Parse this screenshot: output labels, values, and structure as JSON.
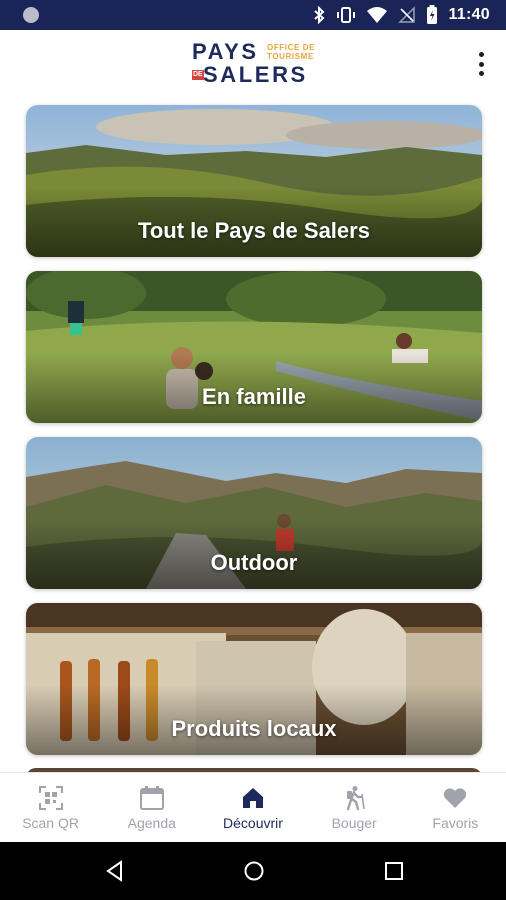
{
  "status_bar": {
    "time": "11:40",
    "icons": [
      "bluetooth-icon",
      "vibrate-icon",
      "wifi-icon",
      "no-signal-icon",
      "battery-icon"
    ]
  },
  "header": {
    "logo": {
      "line1": "PAYS",
      "line2": "SALERS",
      "de": "DE",
      "sub1": "OFFICE DE",
      "sub2": "TOURISME"
    },
    "menu_icon": "more-vert-icon"
  },
  "cards": [
    {
      "label": "Tout le Pays de Salers"
    },
    {
      "label": "En famille"
    },
    {
      "label": "Outdoor"
    },
    {
      "label": "Produits locaux"
    }
  ],
  "bottom_nav": {
    "items": [
      {
        "label": "Scan QR",
        "icon": "qr-scan-icon"
      },
      {
        "label": "Agenda",
        "icon": "calendar-icon"
      },
      {
        "label": "Découvrir",
        "icon": "home-icon",
        "active": true
      },
      {
        "label": "Bouger",
        "icon": "hiker-icon"
      },
      {
        "label": "Favoris",
        "icon": "heart-icon"
      }
    ]
  },
  "colors": {
    "brand_navy": "#1f2a5c",
    "brand_orange": "#e5a63b",
    "brand_red": "#d4433d",
    "inactive": "#a0a3ab"
  }
}
